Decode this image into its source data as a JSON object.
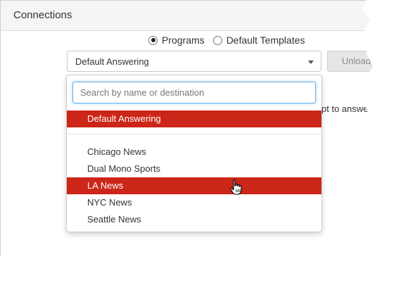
{
  "panel": {
    "title": "Connections"
  },
  "mode": {
    "options": [
      {
        "label": "Programs",
        "checked": true
      },
      {
        "label": "Default Templates",
        "checked": false
      }
    ]
  },
  "program_select": {
    "value": "Default Answering",
    "search_placeholder": "Search by name or destination",
    "search_value": "",
    "options": [
      {
        "label": "Default Answering",
        "selected": true
      },
      {
        "label": "Chicago News",
        "selected": false
      },
      {
        "label": "Dual Mono Sports",
        "selected": false
      },
      {
        "label": "LA News",
        "selected": false,
        "hovered": true
      },
      {
        "label": "NYC News",
        "selected": false
      },
      {
        "label": "Seattle News",
        "selected": false
      }
    ]
  },
  "toolbar": {
    "unload_label": "Unload"
  },
  "background_text": "pt to answe",
  "colors": {
    "highlight": "#cc2619",
    "focus_border": "#66afe9"
  },
  "icons": {
    "cursor": "hand-pointer-icon",
    "caret": "chevron-down-icon"
  }
}
